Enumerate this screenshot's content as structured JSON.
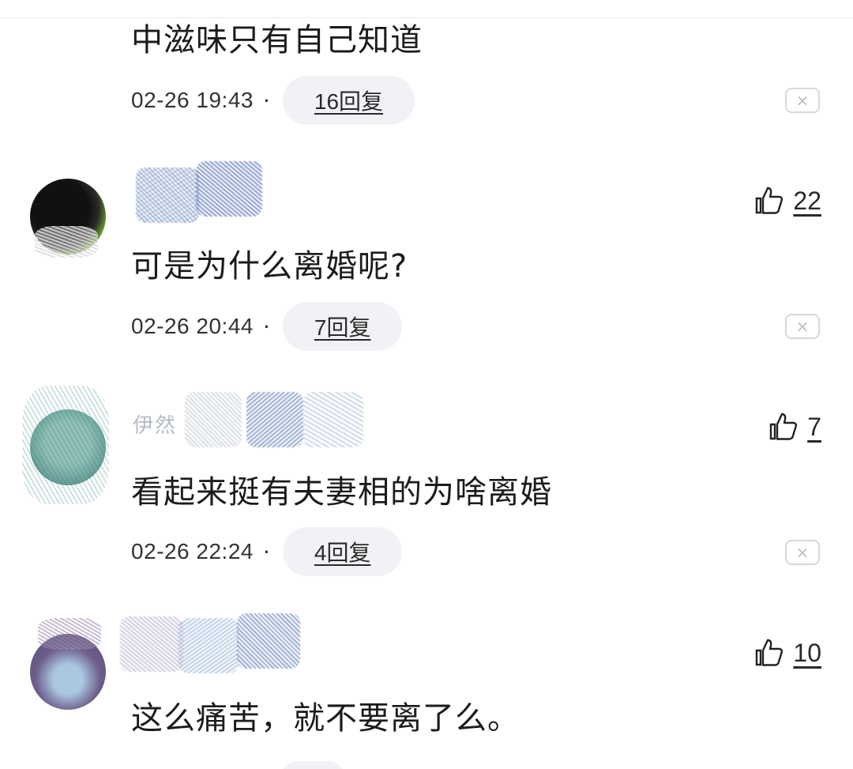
{
  "comments": [
    {
      "text": "中滋味只有自己知道",
      "time": "02-26 19:43",
      "dot": "·",
      "reply": "16回复",
      "close_glyph": "×"
    },
    {
      "username": "",
      "likes": "22",
      "text": "可是为什么离婚呢?",
      "time": "02-26 20:44",
      "dot": "·",
      "reply": "7回复",
      "close_glyph": "×"
    },
    {
      "username": "伊然",
      "likes": "7",
      "text": "看起来挺有夫妻相的为啥离婚",
      "time": "02-26 22:24",
      "dot": "·",
      "reply": "4回复",
      "close_glyph": "×"
    },
    {
      "username": "",
      "likes": "10",
      "text": "这么痛苦，就不要离了么。",
      "time": "",
      "dot": "",
      "reply": "",
      "close_glyph": ""
    }
  ],
  "colors": {
    "pill_bg": "#f0f2f5",
    "divider": "#ececec",
    "text": "#1c1c1c"
  },
  "icons": {
    "like": "thumbs-up-icon",
    "close": "close-icon"
  }
}
